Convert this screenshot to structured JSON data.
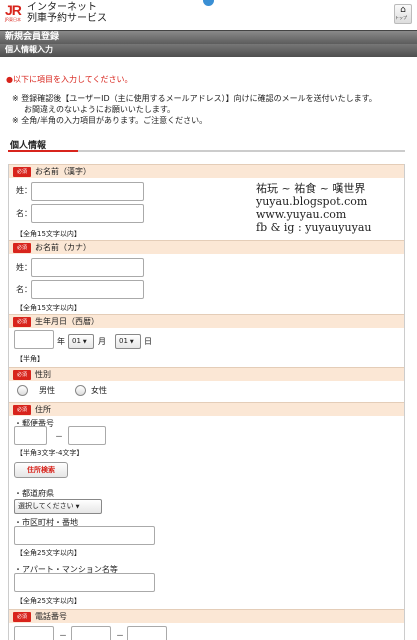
{
  "header": {
    "logo_text": "JR",
    "logo_sub": "JR東日本",
    "title_line1": "インターネット",
    "title_line2": "列車予約サービス",
    "top_button_label": "トップ"
  },
  "titlebar": {
    "title": "新規会員登録",
    "subtitle": "個人情報入力"
  },
  "notice": "●以下に項目を入力してください。",
  "notes": {
    "line1": "※ 登録確認後【ユーザーID（主に使用するメールアドレス）】向けに確認のメールを送付いたします。",
    "line1b": "お間違えのないようにお願いいたします。",
    "line2": "※ 全角/半角の入力項目があります。ご注意ください。"
  },
  "section": {
    "title": "個人情報"
  },
  "required_label": "必須",
  "form": {
    "name_kanji": {
      "label": "お名前（漢字）",
      "sei": "姓：",
      "mei": "名：",
      "hint": "【全角15文字以内】"
    },
    "name_kana": {
      "label": "お名前（カナ）",
      "sei": "姓：",
      "mei": "名：",
      "hint": "【全角15文字以内】"
    },
    "birthdate": {
      "label": "生年月日（西暦）",
      "year_unit": "年",
      "month_value": "01",
      "month_unit": "月",
      "day_value": "01",
      "day_unit": "日",
      "hint": "【半角】"
    },
    "gender": {
      "label": "性別",
      "male": "男性",
      "female": "女性"
    },
    "address": {
      "label": "住所",
      "postal_label": "・郵便番号",
      "postal_dash": "－",
      "postal_hint": "【半角3文字-4文字】",
      "search_button": "住所検索",
      "prefecture_label": "・都道府県",
      "prefecture_value": "選択してください",
      "city_label": "・市区町村・番地",
      "city_hint": "【全角25文字以内】",
      "building_label": "・アパート・マンション名等",
      "building_hint": "【全角25文字以内】"
    },
    "phone": {
      "label": "電話番号",
      "dash": "－"
    }
  },
  "watermark": {
    "line1": "祐玩 ~ 祐食 ~ 嘆世界",
    "line2": "yuyau.blogspot.com",
    "line3": "www.yuyau.com",
    "line4": "fb & ig : yuyauyuyau"
  },
  "colors": {
    "accent": "#d8241c",
    "group_header_bg": "#fbe7d5",
    "titlebar": "#666666"
  }
}
